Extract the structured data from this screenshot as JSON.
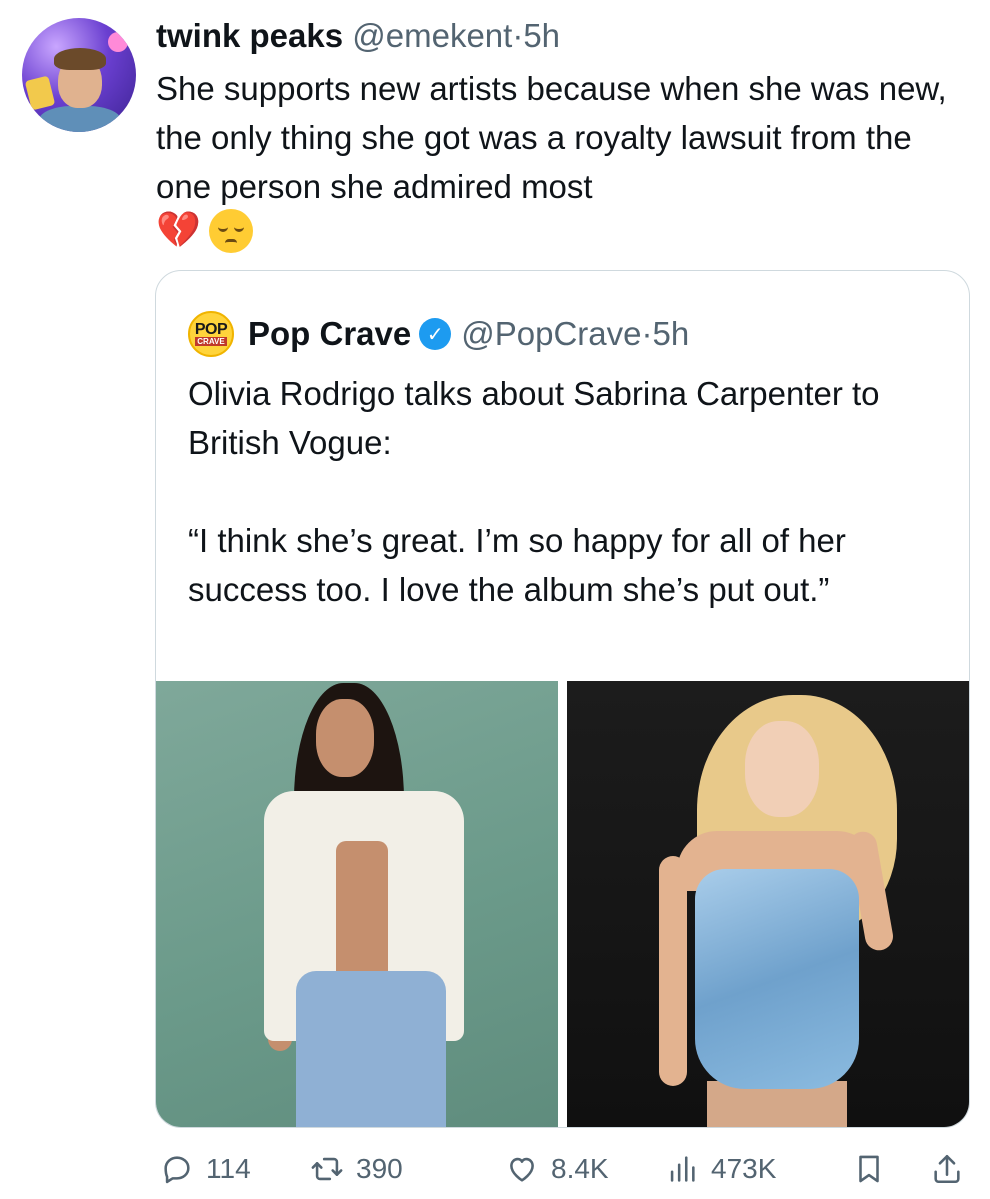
{
  "tweet": {
    "author_name": "twink peaks",
    "author_handle": "@emekent",
    "separator": "·",
    "time": "5h",
    "text": "She supports new artists because when she was new, the only thing she got was a royalty lawsuit from the one person she admired most",
    "emojis": [
      "💔",
      "😔"
    ]
  },
  "quote": {
    "avatar_top": "POP",
    "avatar_bottom": "CRAVE",
    "author_name": "Pop Crave",
    "verified_mark": "✓",
    "author_handle": "@PopCrave",
    "separator": "·",
    "time": "5h",
    "paragraph1": "Olivia Rodrigo talks about Sabrina Carpenter to British Vogue:",
    "paragraph2": "“I think she’s great. I’m so happy for all of her success too. I love the album she’s put out.”"
  },
  "actions": {
    "replies": "114",
    "retweets": "390",
    "likes": "8.4K",
    "views": "473K"
  },
  "colors": {
    "text": "#0f1419",
    "secondary": "#536471",
    "border": "#cfd9de",
    "verified": "#1d9bf0"
  }
}
